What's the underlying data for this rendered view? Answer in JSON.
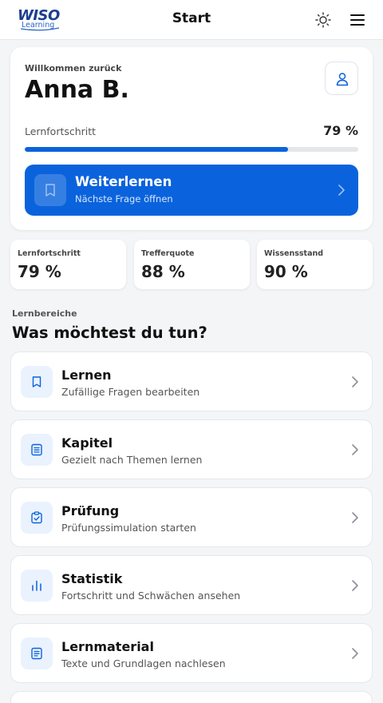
{
  "header": {
    "logo_text": "WISO",
    "logo_sub": "Learning",
    "title": "Start",
    "theme_icon": "sun-icon",
    "menu_icon": "hamburger-menu-icon"
  },
  "welcome": {
    "label": "Willkommen zurück",
    "name": "Anna B.",
    "progress_label": "Lernfortschritt",
    "progress_value": "79 %",
    "progress_fraction": 0.79,
    "cta_title": "Weiterlernen",
    "cta_subtitle": "Nächste Frage öffnen"
  },
  "stats": [
    {
      "label": "Lernfortschritt",
      "value": "79 %"
    },
    {
      "label": "Trefferquote",
      "value": "88 %"
    },
    {
      "label": "Wissensstand",
      "value": "90 %"
    }
  ],
  "section": {
    "label": "Lernbereiche",
    "title": "Was möchtest du tun?"
  },
  "items": [
    {
      "title": "Lernen",
      "subtitle": "Zufällige Fragen bearbeiten",
      "icon": "bookmark-icon"
    },
    {
      "title": "Kapitel",
      "subtitle": "Gezielt nach Themen lernen",
      "icon": "document-list-icon"
    },
    {
      "title": "Prüfung",
      "subtitle": "Prüfungssimulation starten",
      "icon": "clipboard-check-icon"
    },
    {
      "title": "Statistik",
      "subtitle": "Fortschritt und Schwächen ansehen",
      "icon": "bar-chart-icon"
    },
    {
      "title": "Lernmaterial",
      "subtitle": "Texte und Grundlagen nachlesen",
      "icon": "document-text-icon"
    }
  ],
  "colors": {
    "accent": "#0a63dc",
    "icon_bg": "#eaf2fe",
    "logo": "#1b3f8f"
  }
}
